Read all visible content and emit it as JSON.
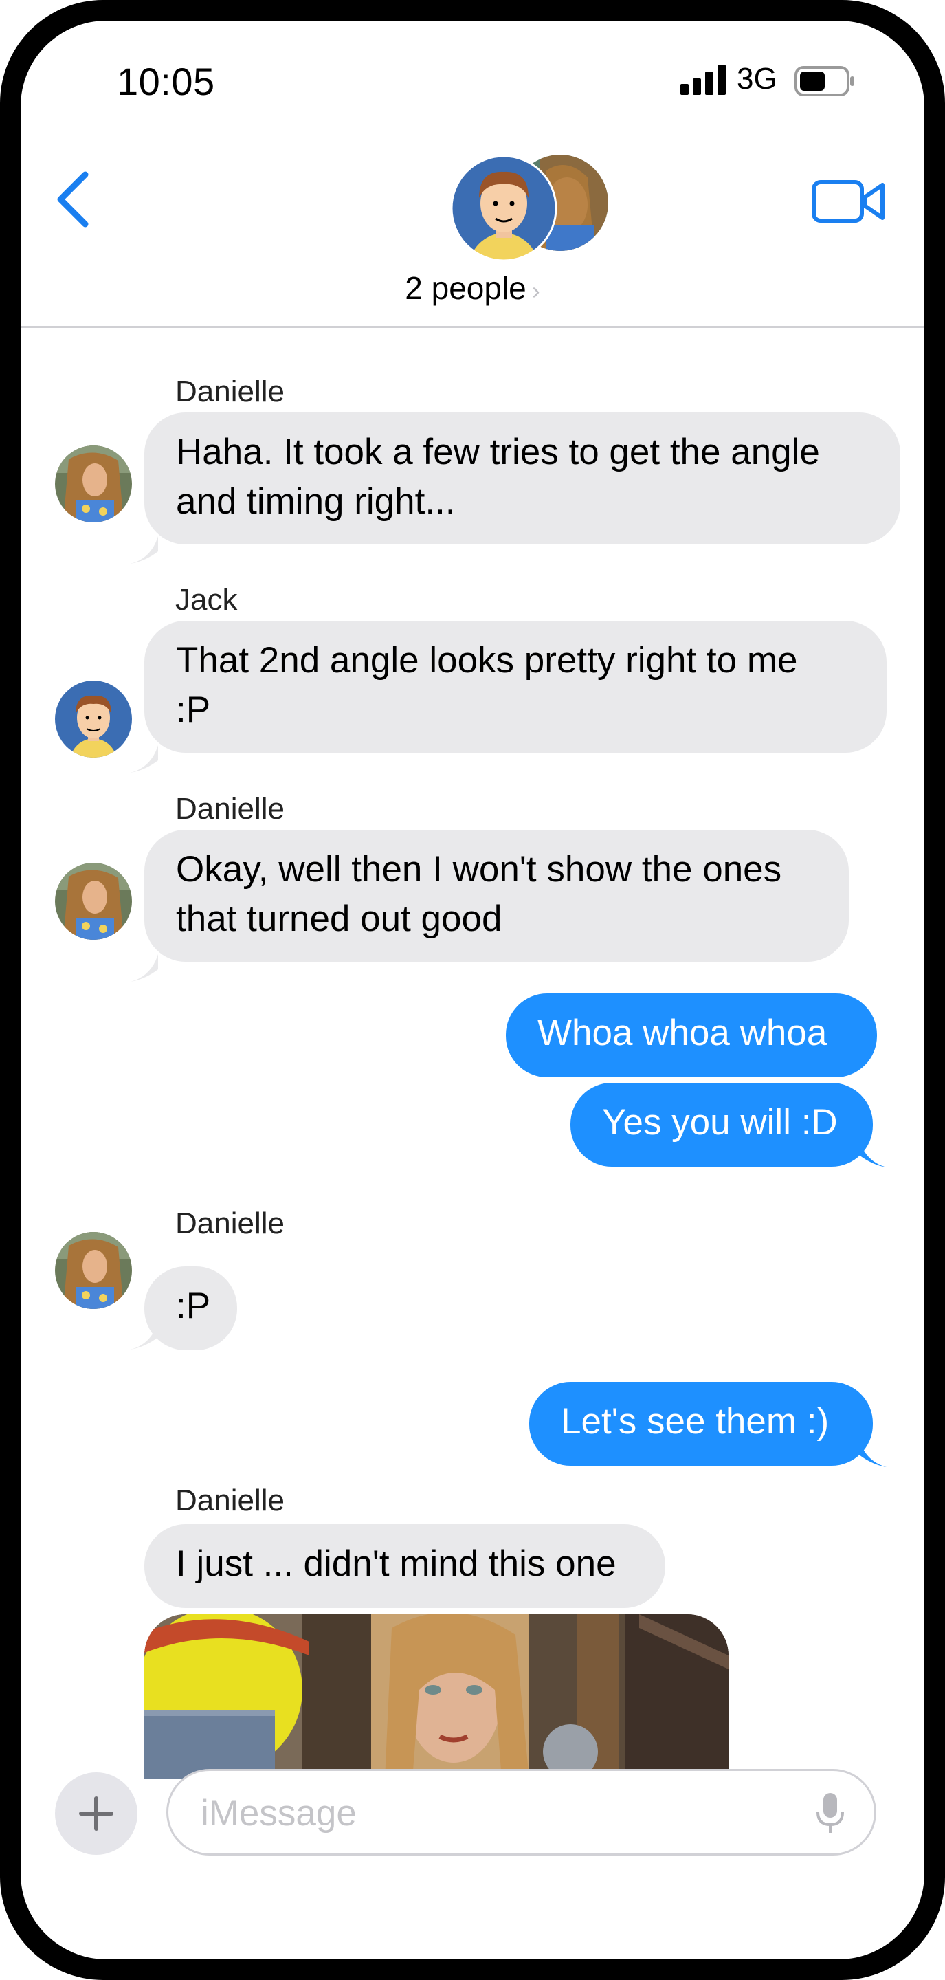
{
  "status_bar": {
    "time": "10:05",
    "network": "3G"
  },
  "header": {
    "group_label": "2 people",
    "chevron": "›"
  },
  "messages": [
    {
      "sender": "Danielle",
      "text1": "Haha. It took a few tries to get the angle",
      "text2": "and timing right..."
    },
    {
      "sender": "Jack",
      "text1": "That 2nd angle looks pretty right to me",
      "text2": ":P"
    },
    {
      "sender": "Danielle",
      "text1": "Okay, well then I won't show the ones",
      "text2": "that turned out good"
    },
    {
      "outgoing": true,
      "text": "Whoa whoa whoa"
    },
    {
      "outgoing": true,
      "text": "Yes you will :D"
    },
    {
      "sender": "Danielle",
      "text": ":P"
    },
    {
      "outgoing": true,
      "text": "Let's see them :)"
    },
    {
      "sender": "Danielle",
      "text": "I just ... didn't mind this one"
    }
  ],
  "input": {
    "placeholder": "iMessage",
    "plus": "+"
  },
  "colors": {
    "accent": "#1e90ff",
    "incoming_bubble": "#e9e9eb"
  },
  "icons": [
    "back-chevron-icon",
    "video-camera-icon",
    "signal-icon",
    "battery-icon",
    "microphone-icon",
    "plus-icon"
  ]
}
